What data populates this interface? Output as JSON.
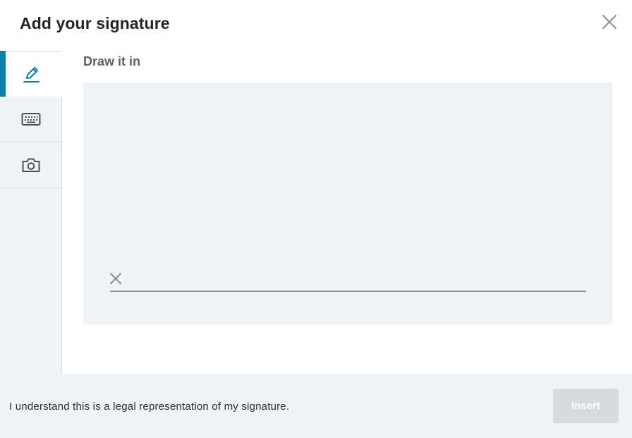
{
  "dialog": {
    "title": "Add your signature",
    "close_icon": "close-icon"
  },
  "sidebar": {
    "tabs": [
      {
        "icon": "pen-icon",
        "mode": "draw",
        "active": true
      },
      {
        "icon": "keyboard-icon",
        "mode": "type",
        "active": false
      },
      {
        "icon": "camera-icon",
        "mode": "upload",
        "active": false
      }
    ]
  },
  "main": {
    "section_label": "Draw it in",
    "signature_marker_icon": "x-mark-icon"
  },
  "footer": {
    "legal_text": "I understand this is a legal representation of my signature.",
    "insert_label": "Insert",
    "insert_enabled": false
  },
  "colors": {
    "accent": "#0e7fa8",
    "panel_bg": "#f0f3f5",
    "disabled_button": "#d8dbdd"
  }
}
